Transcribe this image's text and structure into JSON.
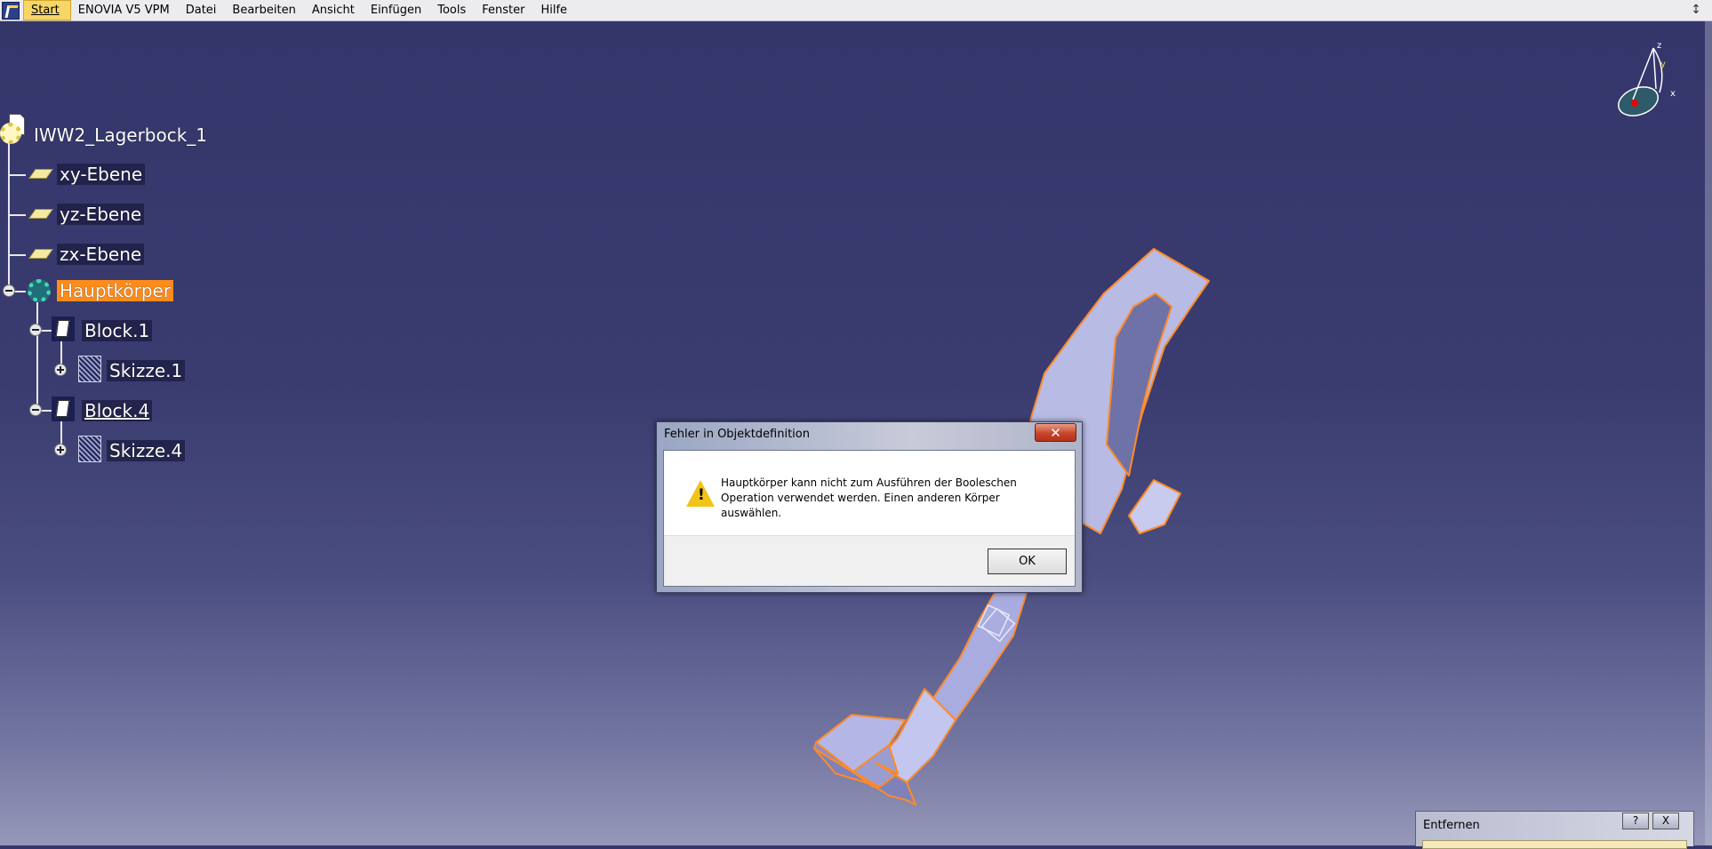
{
  "menubar": {
    "items": [
      "Start",
      "ENOVIA V5 VPM",
      "Datei",
      "Bearbeiten",
      "Ansicht",
      "Einfügen",
      "Tools",
      "Fenster",
      "Hilfe"
    ],
    "window_control": "↕"
  },
  "tree": {
    "root": "IWW2_Lagerbock_1",
    "planes": [
      "xy-Ebene",
      "yz-Ebene",
      "zx-Ebene"
    ],
    "body": "Hauptkörper",
    "features": [
      {
        "name": "Block.1",
        "sketch": "Skizze.1"
      },
      {
        "name": "Block.4",
        "sketch": "Skizze.4"
      }
    ]
  },
  "dialog": {
    "title": "Fehler in Objektdefinition",
    "close": "✕",
    "message": "Hauptkörper kann nicht zum Ausführen der Booleschen Operation verwendet werden. Einen anderen Körper auswählen.",
    "ok": "OK"
  },
  "panel": {
    "title": "Entfernen",
    "help": "?",
    "close": "X"
  },
  "compass": {
    "x": "x",
    "y": "y",
    "z": "z"
  },
  "colors": {
    "selection": "#ff8c1a",
    "part_fill": "#a8abd8",
    "part_edge": "#ff8a2a",
    "background_top": "#34356a"
  }
}
